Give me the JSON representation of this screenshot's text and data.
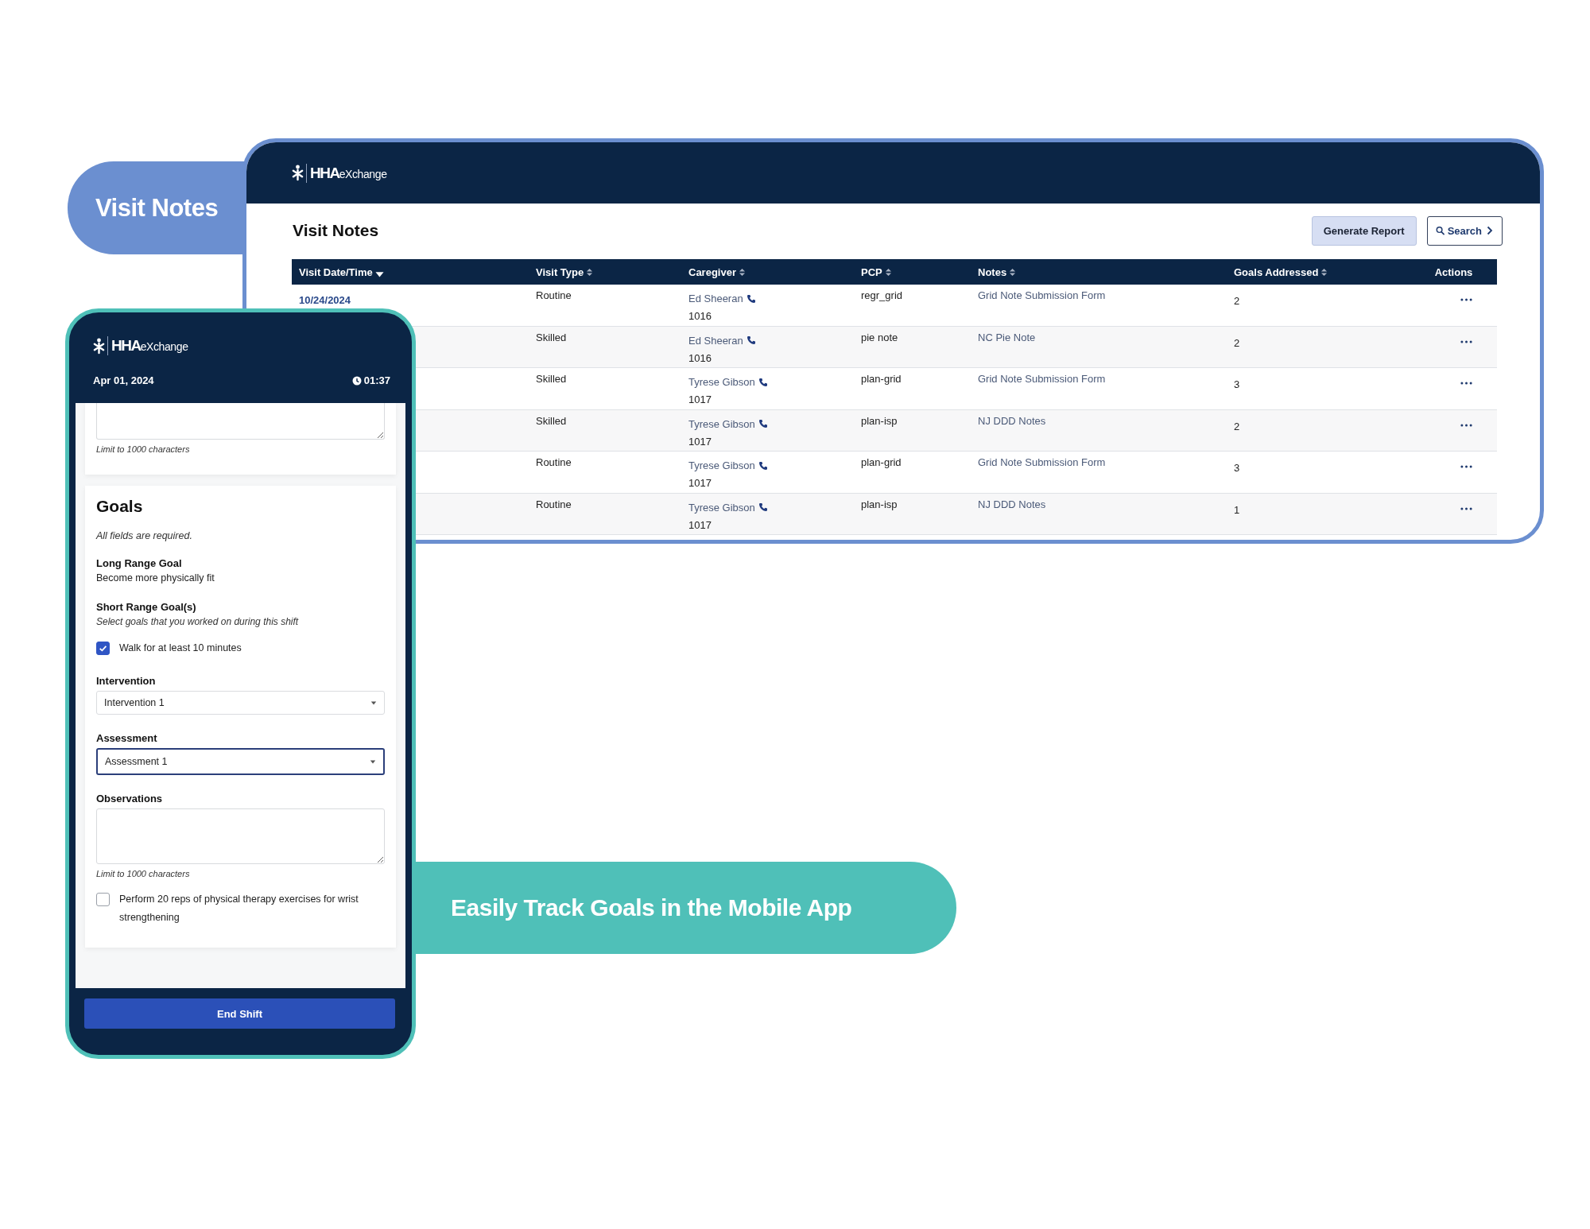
{
  "top_banner": {
    "label": "Visit Notes"
  },
  "desktop": {
    "logo": "**HHA**eXchange",
    "title": "Visit Notes",
    "buttons": [
      {
        "label": "Generate Report",
        "kind": "primary"
      },
      {
        "label": "Search",
        "kind": "search"
      }
    ],
    "table": {
      "columns": [
        {
          "label": "Visit Date/Time",
          "sortable": true,
          "sorted": true
        },
        {
          "label": "Visit Type",
          "sortable": true,
          "sorted": false
        },
        {
          "label": "Caregiver",
          "sortable": true,
          "sorted": false
        },
        {
          "label": "PCP",
          "sortable": true,
          "sorted": false
        },
        {
          "label": "Notes",
          "sortable": true,
          "sorted": false
        },
        {
          "label": "Goals Addressed",
          "sortable": true,
          "sorted": false
        },
        {
          "label": "Actions",
          "sortable": false
        }
      ],
      "rows": [
        {
          "date": "10/24/2024",
          "visit_type": "Routine",
          "caregiver": "Ed Sheeran",
          "caregiver_id": "1016",
          "pcp": "regr_grid",
          "notes": "Grid Note Submission Form",
          "goals": "2"
        },
        {
          "visit_type": "Skilled",
          "caregiver": "Ed Sheeran",
          "caregiver_id": "1016",
          "pcp": "pie note",
          "notes": "NC Pie Note",
          "goals": "2"
        },
        {
          "visit_type": "Skilled",
          "caregiver": "Tyrese Gibson",
          "caregiver_id": "1017",
          "pcp": "plan-grid",
          "notes": "Grid Note Submission Form",
          "goals": "3"
        },
        {
          "visit_type": "Skilled",
          "caregiver": "Tyrese Gibson",
          "caregiver_id": "1017",
          "pcp": "plan-isp",
          "notes": "NJ DDD Notes",
          "goals": "2"
        },
        {
          "visit_type": "Routine",
          "caregiver": "Tyrese Gibson",
          "caregiver_id": "1017",
          "pcp": "plan-grid",
          "notes": "Grid Note Submission Form",
          "goals": "3"
        },
        {
          "visit_type": "Routine",
          "caregiver": "Tyrese Gibson",
          "caregiver_id": "1017",
          "pcp": "plan-isp",
          "notes": "NJ DDD Notes",
          "goals": "1"
        }
      ]
    }
  },
  "mobile": {
    "logo": "**HHA**eXchange",
    "date": "Apr 01, 2024",
    "timer": "01:37",
    "top_hint": "Limit to 1000 characters",
    "goals": {
      "heading": "Goals",
      "required_note": "All fields are required.",
      "long_range_label": "Long Range Goal",
      "long_range_value": "Become more physically fit",
      "short_range_label": "Short Range Goal(s)",
      "short_range_hint": "Select goals that you worked on during this shift",
      "items": [
        {
          "label": "Walk for at least 10 minutes",
          "checked": true,
          "fields": [
            {
              "kind": "select",
              "label": "Intervention",
              "value": "Intervention 1",
              "focused": false
            },
            {
              "kind": "select",
              "label": "Assessment",
              "value": "Assessment 1",
              "focused": true
            },
            {
              "kind": "textarea",
              "label": "Observations",
              "hint": "Limit to 1000 characters"
            }
          ]
        },
        {
          "label": "Perform 20 reps of physical therapy exercises for wrist strengthening",
          "checked": false
        }
      ]
    },
    "end_button": "End Shift"
  },
  "bottom_banner": {
    "label": "Easily Track Goals in the Mobile App"
  }
}
